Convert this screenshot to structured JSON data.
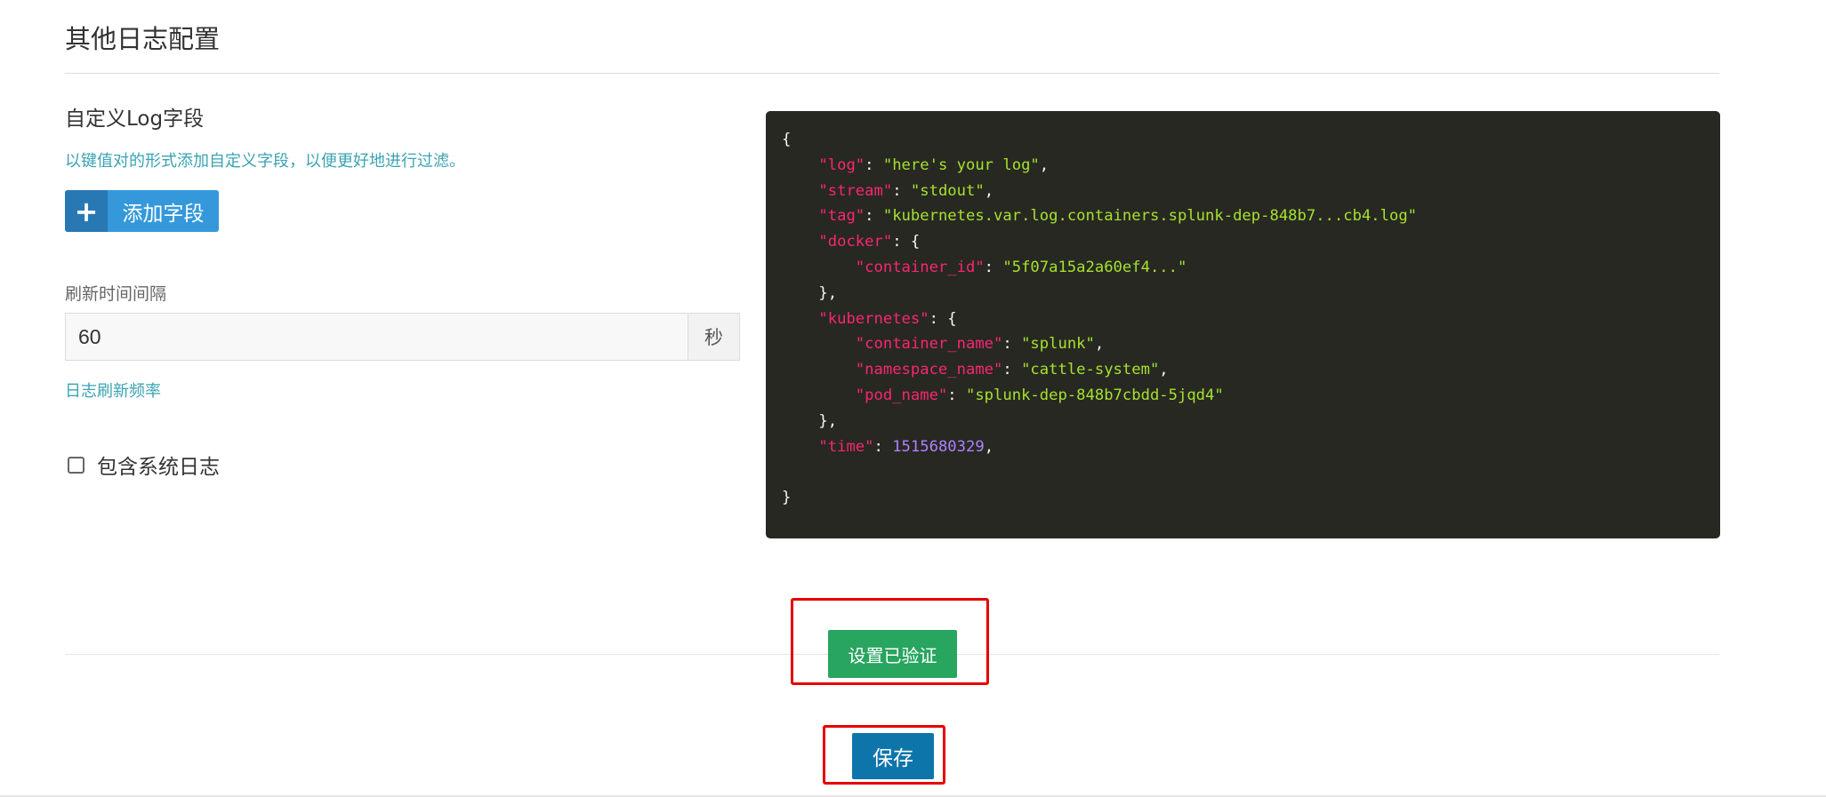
{
  "section": {
    "title": "其他日志配置"
  },
  "custom_fields": {
    "label": "自定义Log字段",
    "hint": "以键值对的形式添加自定义字段，以便更好地进行过滤。",
    "add_button": {
      "icon": "plus-icon",
      "label": "添加字段"
    }
  },
  "refresh": {
    "label": "刷新时间间隔",
    "value": "60",
    "unit": "秒",
    "hint": "日志刷新频率"
  },
  "system_logs": {
    "label": "包含系统日志",
    "checked": false
  },
  "log_example": {
    "open": "{",
    "log_key": "\"log\"",
    "log_value": "\"here's your log\"",
    "stream_key": "\"stream\"",
    "stream_value": "\"stdout\"",
    "tag_key": "\"tag\"",
    "tag_value": "\"kubernetes.var.log.containers.splunk-dep-848b7...cb4.log\"",
    "docker_key": "\"docker\"",
    "container_id_key": "\"container_id\"",
    "container_id_value": "\"5f07a15a2a60ef4...\"",
    "kubernetes_key": "\"kubernetes\"",
    "container_name_key": "\"container_name\"",
    "container_name_value": "\"splunk\"",
    "namespace_name_key": "\"namespace_name\"",
    "namespace_name_value": "\"cattle-system\"",
    "pod_name_key": "\"pod_name\"",
    "pod_name_value": "\"splunk-dep-848b7cbdd-5jqd4\"",
    "time_key": "\"time\"",
    "time_value": "1515680329",
    "close": "}"
  },
  "actions": {
    "verified_label": "设置已验证",
    "save_label": "保存"
  },
  "colors": {
    "code_bg": "#272822",
    "code_key": "#f92672",
    "code_string": "#a6e22e",
    "code_number": "#ae81ff",
    "hint_text": "#3aa3b3",
    "add_button": "#3498db",
    "verified_button": "#28a55f",
    "save_button": "#0d75aa",
    "highlight_box": "#e60000"
  }
}
